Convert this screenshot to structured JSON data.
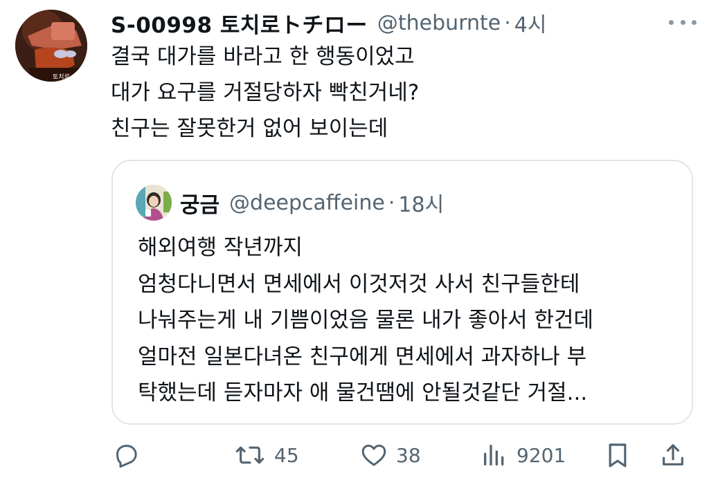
{
  "tweet": {
    "display_name": "S-00998 토치로トチロー",
    "handle": "@theburnte",
    "separator": "·",
    "time": "4시",
    "avatar_icon": "profile-avatar",
    "avatar_caption": "토치로",
    "text_lines": [
      "결국 대가를 바라고 한 행동이었고",
      "대가 요구를 거절당하자 빡친거네?",
      "친구는 잘못한거 없어 보이는데"
    ]
  },
  "quote": {
    "display_name": "궁금",
    "handle": "@deepcaffeine",
    "separator": "·",
    "time": "18시",
    "avatar_icon": "profile-avatar",
    "text_lines": [
      "해외여행 작년까지",
      "엄청다니면서 면세에서 이것저것 사서 친구들한테",
      "나눠주는게 내 기쁨이었음 물론 내가 좋아서 한건데",
      "얼마전 일본다녀온 친구에게 면세에서 과자하나 부",
      "탁했는데 듣자마자 애 물건땜에 안될것같단 거절..."
    ]
  },
  "actions": {
    "reply": {
      "icon": "reply-icon",
      "count": ""
    },
    "retweet": {
      "icon": "retweet-icon",
      "count": "45"
    },
    "like": {
      "icon": "heart-icon",
      "count": "38"
    },
    "views": {
      "icon": "views-icon",
      "count": "9201"
    },
    "bookmark": {
      "icon": "bookmark-icon"
    },
    "share": {
      "icon": "share-icon"
    }
  },
  "colors": {
    "text": "#0f1419",
    "secondary": "#536471",
    "border": "#e1e5e8"
  }
}
